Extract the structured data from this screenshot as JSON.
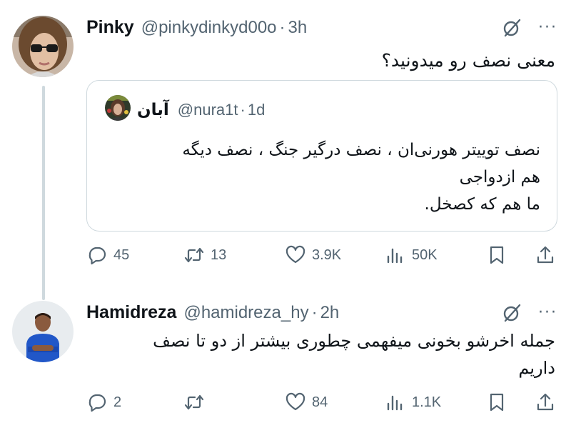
{
  "tweets": [
    {
      "name": "Pinky",
      "handle": "@pinkydinkyd00o",
      "dot": "·",
      "time": "3h",
      "text": "معنی نصف رو میدونید؟",
      "avatar_icon": "user-avatar-sunglasses",
      "quote": {
        "name": "آبان",
        "handle": "@nura1t",
        "dot": "·",
        "time": "1d",
        "text_lines": [
          "نصف تویيتر هورنی‌ان ، نصف درگیر جنگ ، نصف دیگه",
          "هم ازدواجی",
          "ما هم که کصخل."
        ]
      },
      "actions": {
        "replies": "45",
        "reposts": "13",
        "likes": "3.9K",
        "views": "50K"
      }
    },
    {
      "name": "Hamidreza",
      "handle": "@hamidreza_hy",
      "dot": "·",
      "time": "2h",
      "text_lines": [
        "جمله اخرشو بخونی میفهمی چطوری بیشتر از دو تا نصف",
        "داریم"
      ],
      "avatar_icon": "user-avatar-blue-shirt",
      "actions": {
        "replies": "2",
        "reposts": "",
        "likes": "84",
        "views": "1.1K"
      }
    }
  ],
  "icons": {
    "grok": "grok-slash-icon",
    "more": "more-dots-icon",
    "reply": "reply-icon",
    "repost": "repost-icon",
    "like": "heart-icon",
    "views": "views-bar-icon",
    "bookmark": "bookmark-icon",
    "share": "share-icon"
  },
  "more_glyph": "···",
  "colors": {
    "text": "#0f1419",
    "secondary": "#536471",
    "border": "#cfd9de",
    "background": "#ffffff"
  }
}
